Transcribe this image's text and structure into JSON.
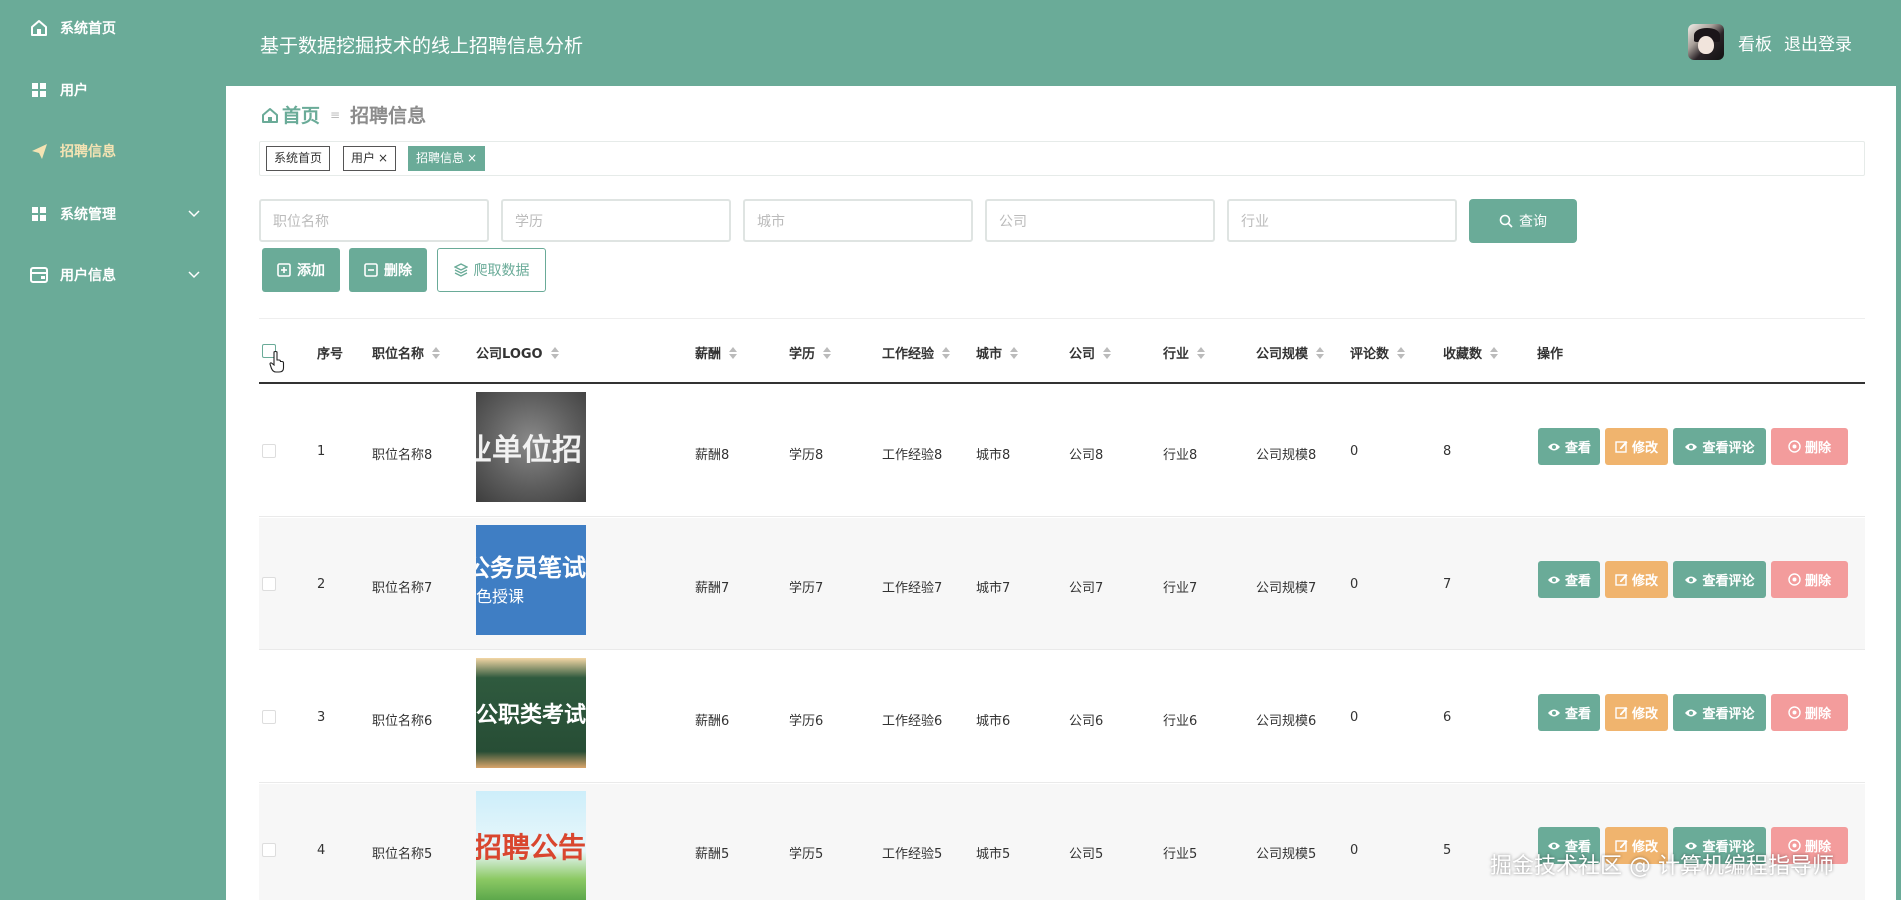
{
  "sidebar": {
    "items": [
      {
        "label": "系统首页",
        "icon": "home-icon"
      },
      {
        "label": "用户",
        "icon": "grid-icon"
      },
      {
        "label": "招聘信息",
        "icon": "send-icon"
      },
      {
        "label": "系统管理",
        "icon": "grid-icon"
      },
      {
        "label": "用户信息",
        "icon": "wallet-icon"
      }
    ]
  },
  "header": {
    "title": "基于数据挖掘技术的线上招聘信息分析",
    "user": "看板",
    "logout": "退出登录"
  },
  "breadcrumb": {
    "home": "首页",
    "current": "招聘信息"
  },
  "tags": [
    {
      "label": "系统首页",
      "close": ""
    },
    {
      "label": "用户",
      "close": "×"
    },
    {
      "label": "招聘信息",
      "close": "×"
    }
  ],
  "search": {
    "job_placeholder": "职位名称",
    "education_placeholder": "学历",
    "city_placeholder": "城市",
    "company_placeholder": "公司",
    "industry_placeholder": "行业",
    "query_label": "查询"
  },
  "actions": {
    "add": "添加",
    "delete": "删除",
    "crawl": "爬取数据"
  },
  "table": {
    "headers": {
      "index": "序号",
      "job": "职位名称",
      "logo": "公司LOGO",
      "salary": "薪酬",
      "education": "学历",
      "experience": "工作经验",
      "city": "城市",
      "company": "公司",
      "industry": "行业",
      "scale": "公司规模",
      "comments": "评论数",
      "favorites": "收藏数",
      "ops": "操作"
    },
    "rows": [
      {
        "index": "1",
        "job": "职位名称8",
        "logo_text": "业单位招",
        "salary": "薪酬8",
        "education": "学历8",
        "experience": "工作经验8",
        "city": "城市8",
        "company": "公司8",
        "industry": "行业8",
        "scale": "公司规模8",
        "comments": "0",
        "favorites": "8"
      },
      {
        "index": "2",
        "job": "职位名称7",
        "logo_text": "公务员笔试",
        "logo_sub": "色授课",
        "salary": "薪酬7",
        "education": "学历7",
        "experience": "工作经验7",
        "city": "城市7",
        "company": "公司7",
        "industry": "行业7",
        "scale": "公司规模7",
        "comments": "0",
        "favorites": "7"
      },
      {
        "index": "3",
        "job": "职位名称6",
        "logo_text": "公职类考试",
        "salary": "薪酬6",
        "education": "学历6",
        "experience": "工作经验6",
        "city": "城市6",
        "company": "公司6",
        "industry": "行业6",
        "scale": "公司规模6",
        "comments": "0",
        "favorites": "6"
      },
      {
        "index": "4",
        "job": "职位名称5",
        "logo_text": "招聘公告",
        "salary": "薪酬5",
        "education": "学历5",
        "experience": "工作经验5",
        "city": "城市5",
        "company": "公司5",
        "industry": "行业5",
        "scale": "公司规模5",
        "comments": "0",
        "favorites": "5"
      }
    ],
    "op_labels": {
      "view": "查看",
      "edit": "修改",
      "comment": "查看评论",
      "delete": "删除"
    }
  },
  "watermark": "掘金技术社区 @ 计算机编程指导师",
  "colors": {
    "primary": "#6aab98",
    "edit": "#f0b46e",
    "danger": "#f39c9c",
    "active_menu": "#f4e3b3"
  }
}
